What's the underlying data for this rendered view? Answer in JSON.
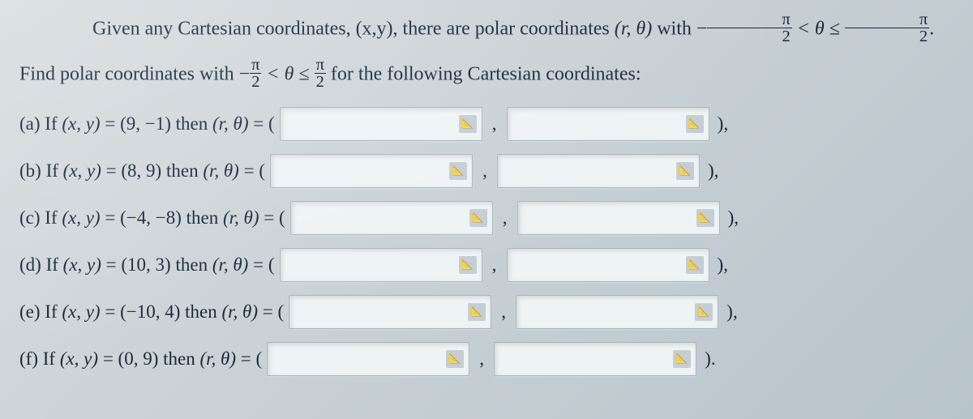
{
  "intro_line1_a": "Given any Cartesian coordinates, (x,y), there are polar coordinates ",
  "intro_line1_b": " with ",
  "intro_line1_range_left": "−",
  "intro_line1_range_mid1": " < θ ≤ ",
  "intro_line1_end": ".",
  "intro_line2_a": "Find polar coordinates with ",
  "intro_line2_range_left": "−",
  "intro_line2_range_mid1": " < θ ≤ ",
  "intro_line2_b": " for the following Cartesian coordinates:",
  "pi": "π",
  "two": "2",
  "rtheta": "(r, θ)",
  "items": [
    {
      "label": "(a)",
      "xy": "(9, −1)",
      "tail": "),"
    },
    {
      "label": "(b)",
      "xy": "(8, 9)",
      "tail": "),"
    },
    {
      "label": "(c)",
      "xy": "(−4, −8)",
      "tail": "),"
    },
    {
      "label": "(d)",
      "xy": "(10, 3)",
      "tail": "),"
    },
    {
      "label": "(e)",
      "xy": "(−10, 4)",
      "tail": "),"
    },
    {
      "label": "(f)",
      "xy": "(0, 9)",
      "tail": ")."
    }
  ],
  "if_text": "If ",
  "xy_text": "(x, y)",
  "eq_text": " = ",
  "then_text": " then ",
  "open_paren": " = (",
  "comma": ","
}
